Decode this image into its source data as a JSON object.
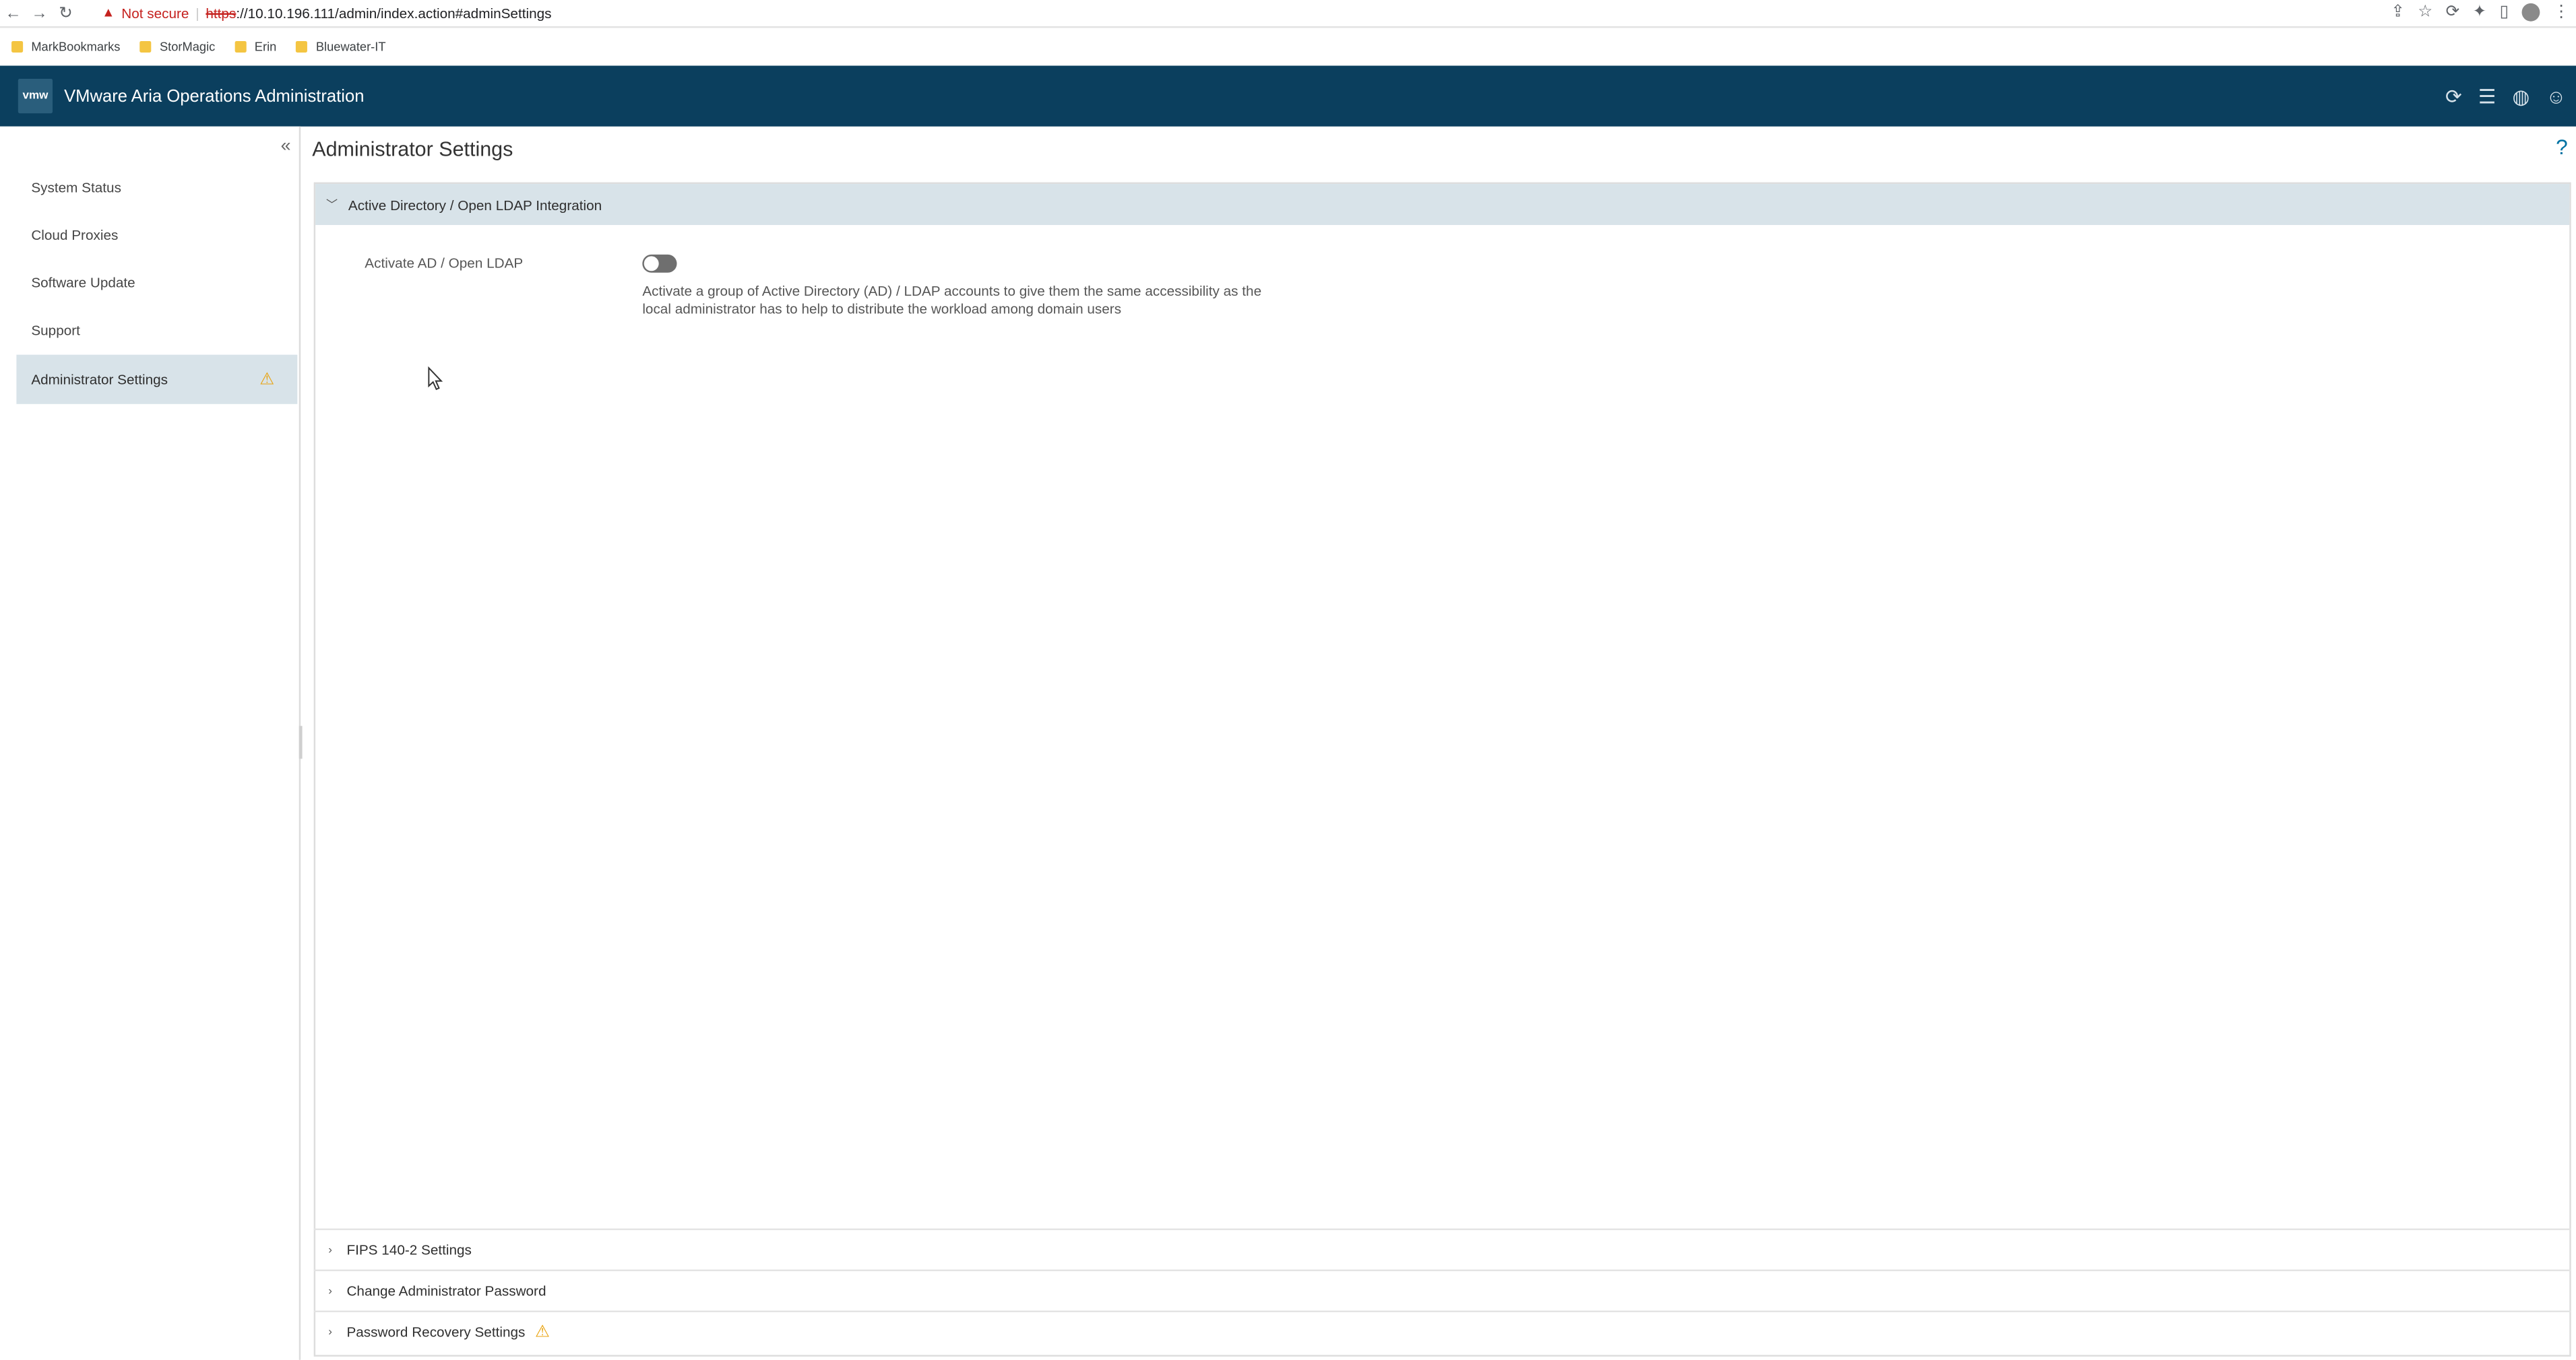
{
  "browser": {
    "security_label": "Not secure",
    "url_scheme": "https",
    "url_rest": "://10.10.196.111/admin/index.action#adminSettings",
    "bookmarks": [
      {
        "label": "MarkBookmarks"
      },
      {
        "label": "StorMagic"
      },
      {
        "label": "Erin"
      },
      {
        "label": "Bluewater-IT"
      }
    ]
  },
  "header": {
    "logo_text": "vmw",
    "title": "VMware Aria Operations Administration"
  },
  "sidebar": {
    "collapse_glyph": "«",
    "items": [
      {
        "label": "System Status"
      },
      {
        "label": "Cloud Proxies"
      },
      {
        "label": "Software Update"
      },
      {
        "label": "Support"
      },
      {
        "label": "Administrator Settings",
        "active": true,
        "warning": true
      }
    ]
  },
  "main": {
    "title": "Administrator Settings",
    "help_glyph": "?",
    "ldap_section": {
      "title": "Active Directory / Open LDAP Integration",
      "field_label": "Activate AD / Open LDAP",
      "toggle_on": false,
      "description_line1": "Activate a group of Active Directory (AD) / LDAP accounts to give them the same accessibility as the",
      "description_line2": "local administrator has to help to distribute the workload among domain users"
    },
    "collapsed_sections": [
      {
        "title": "FIPS 140-2 Settings"
      },
      {
        "title": "Change Administrator Password"
      },
      {
        "title": "Password Recovery Settings",
        "warning": true
      }
    ]
  },
  "colors": {
    "header_bg": "#0b3f5e",
    "active_bg": "#d8e3e9",
    "warning": "#e9a20c",
    "insecure": "#c5221f"
  }
}
